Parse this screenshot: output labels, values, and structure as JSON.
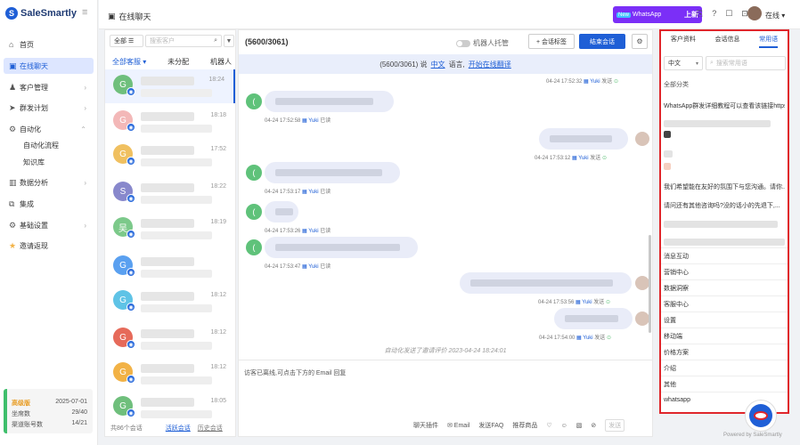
{
  "app": {
    "logo_letter": "S",
    "name": "SaleSmartly",
    "menu_icon": "≡"
  },
  "sidebar": {
    "items": [
      {
        "icon": "⌂",
        "label": "首页",
        "chevron": ""
      },
      {
        "icon": "▣",
        "label": "在线聊天",
        "chevron": ""
      },
      {
        "icon": "♟",
        "label": "客户管理",
        "chevron": "›"
      },
      {
        "icon": "➤",
        "label": "群发计划",
        "chevron": "›"
      },
      {
        "icon": "⚙",
        "label": "自动化",
        "chevron": "⌃"
      },
      {
        "icon": "▥",
        "label": "数据分析",
        "chevron": "›"
      },
      {
        "icon": "⧉",
        "label": "集成",
        "chevron": ""
      },
      {
        "icon": "⚙",
        "label": "基础设置",
        "chevron": "›"
      },
      {
        "icon": "★",
        "label": "邀请返现",
        "chevron": ""
      }
    ],
    "sub_items": [
      "自动化流程",
      "知识库"
    ],
    "plan": {
      "name": "高级版",
      "expire": "2025-07-01",
      "seats_label": "坐席数",
      "seats_value": "29/40",
      "channels_label": "渠道账号数",
      "channels_value": "14/21"
    }
  },
  "topbar": {
    "title_icon": "▣",
    "title": "在线聊天",
    "wa_new": "New",
    "wa_label": "WhatsApp",
    "wa_upgrade": "上新",
    "icons": [
      "⎘",
      "?",
      "☐",
      "⊡"
    ],
    "status": "在线 ▾"
  },
  "chat_list": {
    "filter": "全部 ☰",
    "search_placeholder": "搜索客户",
    "search_icon": "⌕",
    "funnel_icon": "▼",
    "tabs": [
      "全部客服 ▾",
      "未分配",
      "机器人"
    ],
    "conversations": [
      {
        "initial": "G",
        "color": "#6fbf7c",
        "time": "18:24"
      },
      {
        "initial": "G",
        "color": "#f3b8b8",
        "time": "18:18"
      },
      {
        "initial": "G",
        "color": "#f0c060",
        "time": "17:52"
      },
      {
        "initial": "S",
        "color": "#8888cc",
        "time": "18:22"
      },
      {
        "initial": "吴",
        "color": "#7cc98a",
        "time": "18:19"
      },
      {
        "initial": "G",
        "color": "#5aa0f0",
        "time": ""
      },
      {
        "initial": "G",
        "color": "#5fc3e6",
        "time": "18:12"
      },
      {
        "initial": "G",
        "color": "#e66a5a",
        "time": "18:12"
      },
      {
        "initial": "G",
        "color": "#f2b246",
        "time": "18:12"
      },
      {
        "initial": "G",
        "color": "#6fbf7c",
        "time": "18:05"
      }
    ],
    "footer_count": "共86个会话",
    "footer_active": "活跃会话",
    "footer_history": "历史会话"
  },
  "chat": {
    "title": "(5600/3061)",
    "robot_label": "机器人托管",
    "tag_btn": "+ 会话标签",
    "end_btn": "结束会话",
    "gear_icon": "⚙",
    "notice": {
      "prefix": "(5600/3061) 说",
      "lang": "中文",
      "mid": "语言,",
      "link": "开始在线翻译"
    },
    "messages": [
      {
        "side": "left",
        "meta": "04-24 17:52:58",
        "agent": "Yuki",
        "status": "已读"
      },
      {
        "side": "right",
        "meta": "04-24 17:53:12",
        "agent": "Yuki",
        "status": "发送"
      },
      {
        "side": "left",
        "meta": "04-24 17:53:17",
        "agent": "Yuki",
        "status": "已读"
      },
      {
        "side": "left",
        "meta": "04-24 17:53:26",
        "agent": "Yuki",
        "status": "已读"
      },
      {
        "side": "left",
        "meta": "04-24 17:53:47",
        "agent": "Yuki",
        "status": "已读"
      },
      {
        "side": "right",
        "meta": "04-24 17:53:56",
        "agent": "Yuki",
        "status": "发送"
      },
      {
        "side": "right",
        "meta": "04-24 17:54:00",
        "agent": "Yuki",
        "status": "发送"
      }
    ],
    "top_meta": "04-24 17:52:32",
    "system_text": "自动化发送了邀请评价 2023-04-24 18:24:01",
    "input_placeholder": "访客已离线,可点击下方的 Email 回复",
    "tools": [
      "聊天插件",
      "✉ Email",
      "发送FAQ",
      "推荐商品",
      "♡",
      "☺",
      "▧",
      "⊘"
    ],
    "send": "发送"
  },
  "right_panel": {
    "tabs": [
      "客户资料",
      "会话信息",
      "常用语"
    ],
    "lang": "中文",
    "search_placeholder": "搜索常用语",
    "category_head": "全部分类",
    "phrases": [
      "WhatsApp群发详细教程可以查看该链接https...",
      "我们希望能在友好的氛围下与您沟通。请你...",
      "请问还有其他咨询吗?没的话小的先退下,..."
    ],
    "categories": [
      "消息互动",
      "营销中心",
      "数据洞察",
      "客服中心",
      "设置",
      "移动端",
      "价格方案",
      "介绍",
      "其他",
      "whatsapp"
    ]
  },
  "powered": "Powered by SaleSmartly",
  "colors": {
    "accent": "#1f5fd6",
    "highlight_border": "#e0262b",
    "whatsapp_btn": "#7b2ff7"
  }
}
